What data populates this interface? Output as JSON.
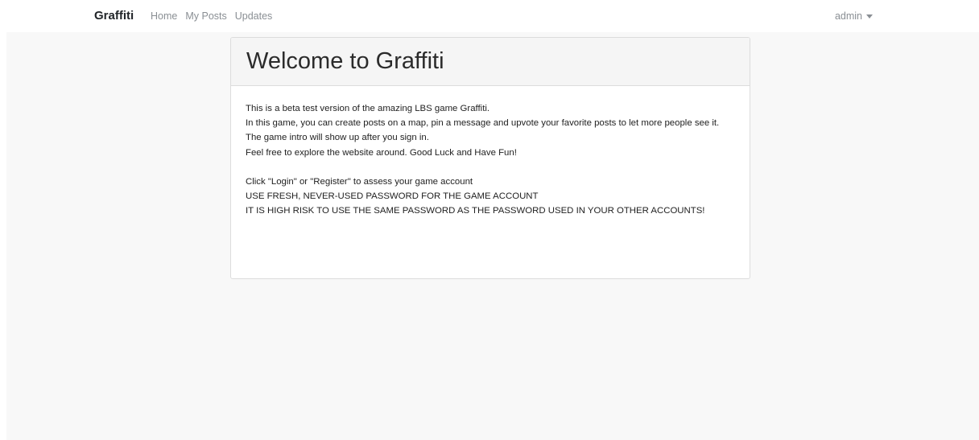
{
  "navbar": {
    "brand": "Graffiti",
    "links": [
      "Home",
      "My Posts",
      "Updates"
    ],
    "user": "admin"
  },
  "card": {
    "title": "Welcome to Graffiti",
    "paragraphs_1": [
      "This is a beta test version of the amazing LBS game Graffiti.",
      "In this game, you can create posts on a map, pin a message and upvote your favorite posts to let more people see it.",
      "The game intro will show up after you sign in.",
      "Feel free to explore the website around. Good Luck and Have Fun!"
    ],
    "paragraphs_2": [
      "Click \"Login\" or \"Register\" to assess your game account",
      "USE FRESH, NEVER-USED PASSWORD FOR THE GAME ACCOUNT",
      "IT IS HIGH RISK TO USE THE SAME PASSWORD AS THE PASSWORD USED IN YOUR OTHER ACCOUNTS!"
    ]
  }
}
